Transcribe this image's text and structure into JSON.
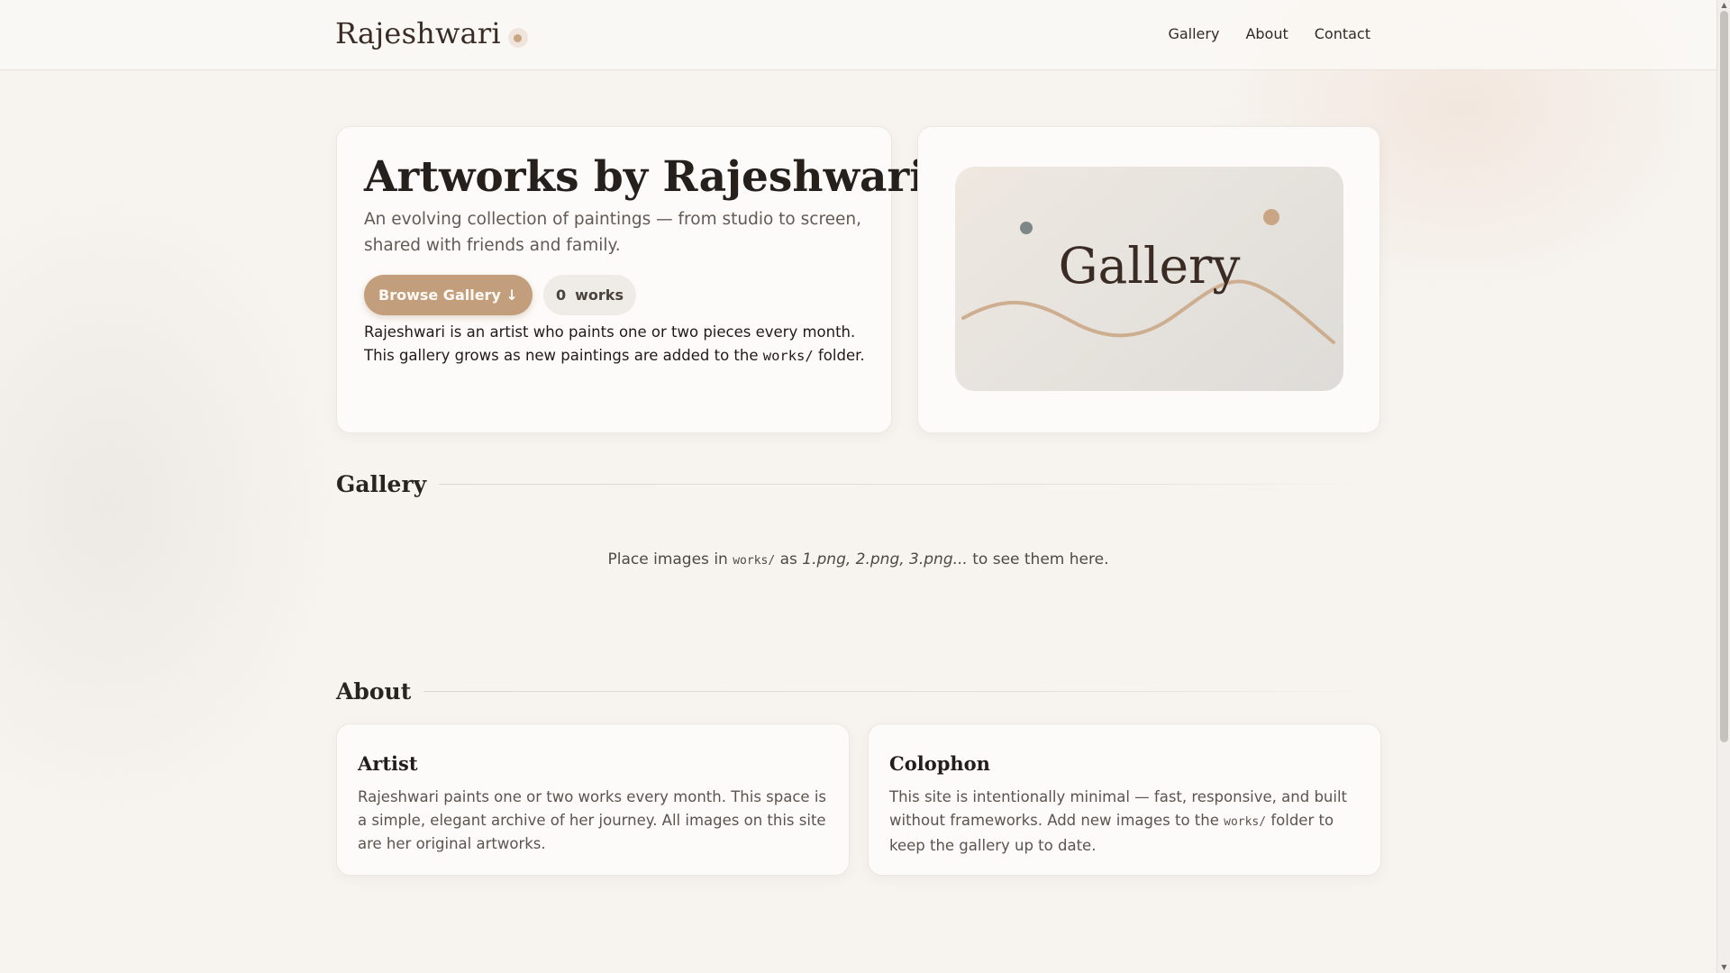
{
  "header": {
    "brand": "Rajeshwari",
    "nav": [
      "Gallery",
      "About",
      "Contact"
    ]
  },
  "hero": {
    "title": "Artworks by Rajeshwari",
    "subtitle": "An evolving collection of paintings — from studio to screen, shared with friends and family.",
    "browse_button": "Browse Gallery ↓",
    "count_value": "0",
    "count_label": "works",
    "desc_before": "Rajeshwari is an artist who paints one or two pieces every month. This gallery grows as new paintings are added to the ",
    "desc_code": "works/",
    "desc_after": " folder."
  },
  "preview": {
    "label": "Gallery",
    "colors": {
      "dot_dark": "#7d8886",
      "dot_accent": "#c9a583",
      "wave": "#c9a583"
    }
  },
  "gallery": {
    "heading": "Gallery",
    "empty_before": "Place images in ",
    "empty_code": "works/",
    "empty_mid": " as ",
    "empty_em": "1.png, 2.png, 3.png...",
    "empty_after": " to see them here."
  },
  "about": {
    "heading": "About",
    "artist": {
      "title": "Artist",
      "body": "Rajeshwari paints one or two works every month. This space is a simple, elegant archive of her journey. All images on this site are her original artworks."
    },
    "colophon": {
      "title": "Colophon",
      "body_before": "This site is intentionally minimal — fast, responsive, and built without frameworks. Add new images to the ",
      "body_code": "works/",
      "body_after": " folder to keep the gallery up to date."
    }
  },
  "theme": {
    "accent": "#c39e7c",
    "background": "#f7f4f0",
    "card": "#fdfbf9"
  }
}
